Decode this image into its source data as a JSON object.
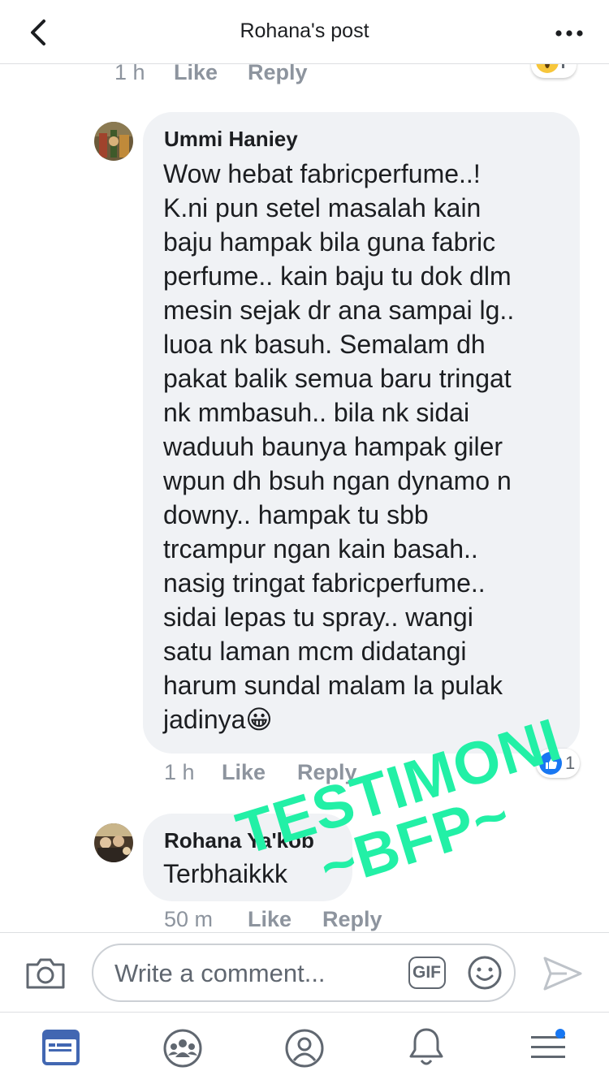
{
  "header": {
    "title": "Rohana's post"
  },
  "prev_comment_meta": {
    "time": "1 h",
    "like": "Like",
    "reply": "Reply"
  },
  "comments": [
    {
      "name": "Ummi Haniey",
      "lines": [
        "Wow hebat fabricperfume..!",
        "K.ni pun setel masalah kain",
        "baju hampak bila guna fabric",
        "perfume.. kain baju tu dok dlm",
        "mesin sejak dr ana sampai lg..",
        "luoa nk basuh. Semalam dh",
        "pakat balik semua baru tringat",
        "nk mmbasuh.. bila nk sidai",
        "waduuh baunya hampak giler",
        "wpun dh bsuh ngan dynamo n",
        "downy.. hampak tu sbb",
        "trcampur ngan kain basah..",
        "nasig tringat fabricperfume..",
        "sidai lepas tu spray.. wangi",
        "satu laman mcm didatangi",
        "harum sundal malam la pulak",
        "jadinya😀"
      ],
      "time": "1 h",
      "like": "Like",
      "reply": "Reply",
      "reaction_count": "1",
      "reaction_icon": "like-reaction-icon"
    },
    {
      "name": "Rohana Ya'kob",
      "lines": [
        "Terbhaikkk"
      ],
      "time": "50 m",
      "like": "Like",
      "reply": "Reply"
    }
  ],
  "watermark": {
    "line1": "TESTIMONI",
    "line2": "~BFP~",
    "color": "#22f0a6"
  },
  "composer": {
    "placeholder": "Write a comment...",
    "gif_label": "GIF"
  },
  "tabs": [
    "news-feed-icon",
    "groups-icon",
    "profile-icon",
    "notifications-icon",
    "menu-icon"
  ],
  "colors": {
    "accent": "#4267b2",
    "like_blue": "#1877f2",
    "meta_gray": "#8d949e",
    "bubble_bg": "#f0f2f5"
  }
}
